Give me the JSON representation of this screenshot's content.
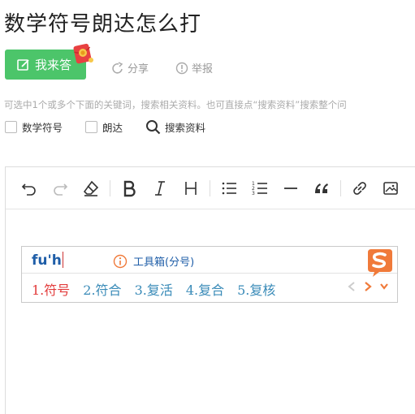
{
  "page": {
    "title": "数学符号朗达怎么打"
  },
  "actions": {
    "answer_label": "我来答",
    "share_label": "分享",
    "report_label": "举报"
  },
  "hint": "可选中1个或多个下面的关键词，搜索相关资料。也可直接点“搜索资料”搜索整个问",
  "keywords": {
    "items": [
      "数学符号",
      "朗达"
    ],
    "search_label": "搜索资料"
  },
  "toolbar": {
    "buttons": [
      "undo",
      "redo",
      "eraser",
      "bold",
      "italic",
      "heading",
      "bullet-list",
      "numbered-list",
      "divider",
      "quote",
      "link",
      "image"
    ]
  },
  "ime": {
    "input": "fu'h",
    "tool_label": "工具箱(分号)",
    "candidates": [
      "1.符号",
      "2.符合",
      "3.复活",
      "4.复合",
      "5.复核"
    ]
  },
  "colors": {
    "answer_green": "#4cc56a",
    "candidate_active": "#e23a3a",
    "candidate": "#3a8bb8",
    "ime_input": "#1f5ea8",
    "sogou_orange": "#f07a3a"
  },
  "icons": {
    "share": "share-icon",
    "report": "report-icon",
    "search": "search-icon",
    "sogou": "sogou-logo-icon"
  }
}
